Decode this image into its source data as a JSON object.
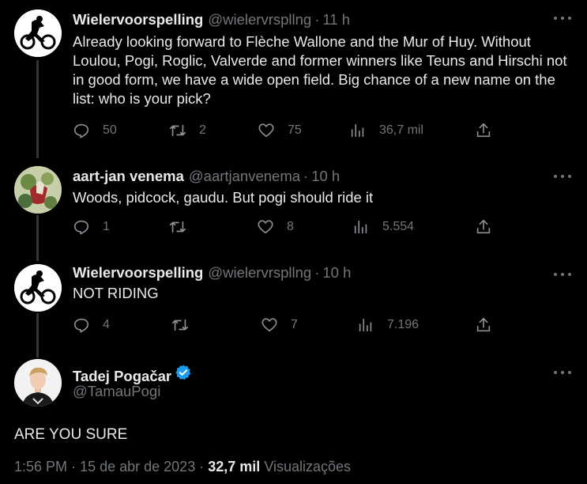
{
  "tweets": [
    {
      "name": "Wielervoorspelling",
      "handle": "@wielervrspllng",
      "time": "11 h",
      "text": "Already looking forward to Flèche Wallone and the Mur of Huy. Without Loulou, Pogi, Roglic, Valverde and former winners like Teuns and Hirschi not in good form, we have a wide open field. Big chance of a new name on the  list: who is your pick?",
      "replies": "50",
      "retweets": "2",
      "likes": "75",
      "views": "36,7 mil"
    },
    {
      "name": "aart-jan venema",
      "handle": "@aartjanvenema",
      "time": "10 h",
      "text": "Woods, pidcock, gaudu. But pogi should ride it",
      "replies": "1",
      "retweets": "",
      "likes": "8",
      "views": "5.554"
    },
    {
      "name": "Wielervoorspelling",
      "handle": "@wielervrspllng",
      "time": "10 h",
      "text": "NOT RIDING",
      "replies": "4",
      "retweets": "",
      "likes": "7",
      "views": "7.196"
    }
  ],
  "main_tweet": {
    "name": "Tadej Pogačar",
    "handle": "@TamauPogi",
    "text": "ARE YOU SURE",
    "time": "1:56 PM",
    "date": "15 de abr de 2023",
    "views_count": "32,7 mil",
    "views_label": "Visualizações"
  },
  "separator": "·",
  "colors": {
    "background": "#000000",
    "text": "#e7e9ea",
    "muted": "#71767b",
    "verified": "#1d9bf0"
  }
}
